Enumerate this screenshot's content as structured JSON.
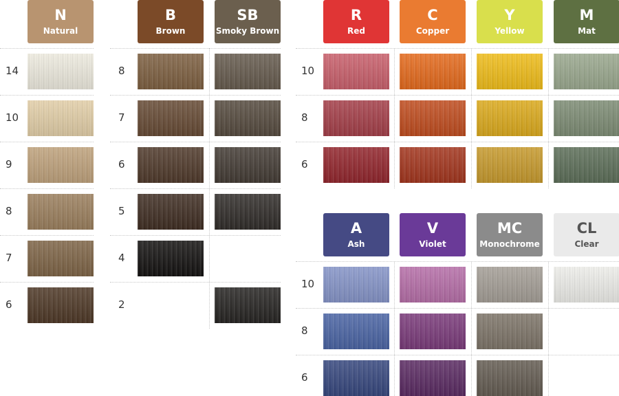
{
  "groups": [
    {
      "columns": [
        {
          "code": "N",
          "name": "Natural",
          "color": "#b89470"
        }
      ],
      "rows": [
        {
          "label": "14",
          "cells": [
            "#eeebdf"
          ]
        },
        {
          "label": "10",
          "cells": [
            "#e3cfa8"
          ]
        },
        {
          "label": "9",
          "cells": [
            "#bfa27c"
          ]
        },
        {
          "label": "8",
          "cells": [
            "#9b7f5d"
          ]
        },
        {
          "label": "7",
          "cells": [
            "#7e6446"
          ]
        },
        {
          "label": "6",
          "cells": [
            "#4e3826"
          ]
        }
      ]
    },
    {
      "columns": [
        {
          "code": "B",
          "name": "Brown",
          "color": "#7b4a28"
        },
        {
          "code": "SB",
          "name": "Smoky Brown",
          "color": "#6b5f4e"
        }
      ],
      "rows": [
        {
          "label": "8",
          "cells": [
            "#7d5f40",
            "#655a4d"
          ]
        },
        {
          "label": "7",
          "cells": [
            "#664a34",
            "#554a3e"
          ]
        },
        {
          "label": "6",
          "cells": [
            "#4f392a",
            "#433b34"
          ]
        },
        {
          "label": "5",
          "cells": [
            "#3f2d22",
            "#302c29"
          ]
        },
        {
          "label": "4",
          "cells": [
            "#141211",
            null
          ]
        },
        {
          "label": "2",
          "cells": [
            null,
            "#262422"
          ]
        }
      ]
    },
    {
      "columns": [
        {
          "code": "R",
          "name": "Red",
          "color": "#e03535"
        },
        {
          "code": "C",
          "name": "Copper",
          "color": "#ea7b31"
        },
        {
          "code": "Y",
          "name": "Yellow",
          "color": "#d9df4c"
        },
        {
          "code": "M",
          "name": "Mat",
          "color": "#5e7042"
        }
      ],
      "rows": [
        {
          "label": "10",
          "cells": [
            "#c95f6b",
            "#e56a1c",
            "#f0bd19",
            "#9aa88e"
          ]
        },
        {
          "label": "8",
          "cells": [
            "#a43e48",
            "#c04c1e",
            "#dcaa1c",
            "#7d8c74"
          ]
        },
        {
          "label": "6",
          "cells": [
            "#92252c",
            "#a3351d",
            "#c79a2c",
            "#5c6e58"
          ]
        }
      ]
    },
    {
      "columns": [
        {
          "code": "A",
          "name": "Ash",
          "color": "#454a84"
        },
        {
          "code": "V",
          "name": "Violet",
          "color": "#6a3a98"
        },
        {
          "code": "MC",
          "name": "Monochrome",
          "color": "#8b8b8b"
        },
        {
          "code": "CL",
          "name": "Clear",
          "color": "#eaeaea"
        }
      ],
      "rows": [
        {
          "label": "10",
          "cells": [
            "#8594c8",
            "#b66ea8",
            "#a49e96",
            "#eeeeea"
          ]
        },
        {
          "label": "8",
          "cells": [
            "#4a64a4",
            "#7a3a7a",
            "#7d7468",
            null
          ]
        },
        {
          "label": "6",
          "cells": [
            "#36477e",
            "#5a2a62",
            "#645c52",
            null
          ]
        }
      ]
    }
  ]
}
